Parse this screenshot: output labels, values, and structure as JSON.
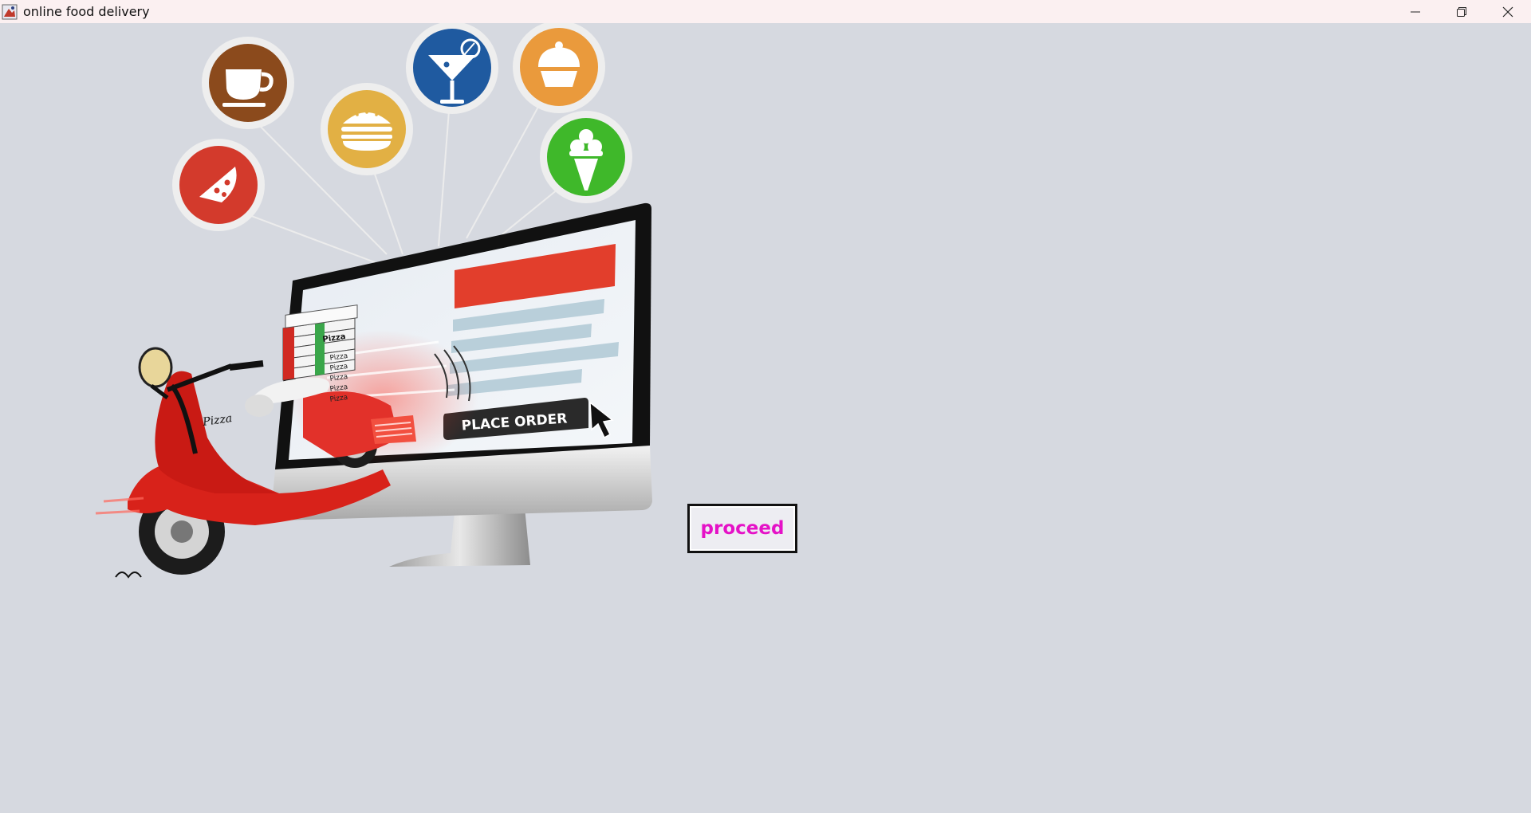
{
  "window": {
    "title": "online food delivery"
  },
  "illustration": {
    "screen_button_label": "PLACE ORDER",
    "box_labels": [
      "Pizza",
      "Pizza",
      "Pizza",
      "Pizza",
      "Pizza",
      "Pizza"
    ],
    "scooter_label": "Pizza",
    "icons": [
      "pizza-icon",
      "coffee-cup-icon",
      "burger-icon",
      "cocktail-icon",
      "cupcake-icon",
      "ice-cream-icon"
    ],
    "colors": {
      "pizza": "#d33a2c",
      "coffee": "#8b4a1c",
      "burger": "#e2b044",
      "cocktail": "#1f5aa0",
      "cupcake": "#ea9a3c",
      "icecream": "#3fb82a",
      "banner": "#e23e2c",
      "scooter": "#d8221a"
    }
  },
  "actions": {
    "proceed_label": "proceed",
    "proceed_color": "#e512c7"
  }
}
